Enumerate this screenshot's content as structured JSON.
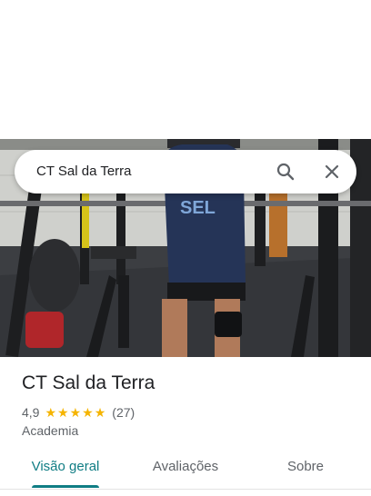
{
  "search": {
    "query": "CT Sal da Terra"
  },
  "place": {
    "name": "CT Sal da Terra",
    "rating": "4,9",
    "stars": 5,
    "review_count": "(27)",
    "category": "Academia"
  },
  "photo": {
    "shirt_text": "SEL"
  },
  "tabs": [
    {
      "label": "Visão geral",
      "active": true
    },
    {
      "label": "Avaliações",
      "active": false
    },
    {
      "label": "Sobre",
      "active": false
    }
  ],
  "colors": {
    "accent": "#107d84",
    "star": "#f5b400",
    "text_primary": "#202124",
    "text_secondary": "#5f6368"
  },
  "icons": {
    "search": "search-icon",
    "close": "close-icon"
  }
}
